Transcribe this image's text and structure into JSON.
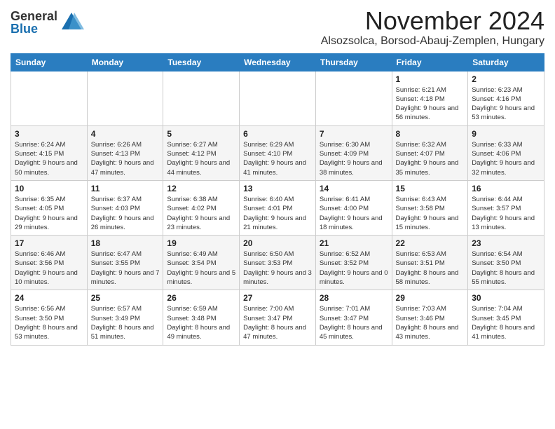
{
  "header": {
    "logo_general": "General",
    "logo_blue": "Blue",
    "month_title": "November 2024",
    "location": "Alsozsolca, Borsod-Abauj-Zemplen, Hungary"
  },
  "weekdays": [
    "Sunday",
    "Monday",
    "Tuesday",
    "Wednesday",
    "Thursday",
    "Friday",
    "Saturday"
  ],
  "weeks": [
    [
      {
        "day": "",
        "detail": ""
      },
      {
        "day": "",
        "detail": ""
      },
      {
        "day": "",
        "detail": ""
      },
      {
        "day": "",
        "detail": ""
      },
      {
        "day": "",
        "detail": ""
      },
      {
        "day": "1",
        "detail": "Sunrise: 6:21 AM\nSunset: 4:18 PM\nDaylight: 9 hours and 56 minutes."
      },
      {
        "day": "2",
        "detail": "Sunrise: 6:23 AM\nSunset: 4:16 PM\nDaylight: 9 hours and 53 minutes."
      }
    ],
    [
      {
        "day": "3",
        "detail": "Sunrise: 6:24 AM\nSunset: 4:15 PM\nDaylight: 9 hours and 50 minutes."
      },
      {
        "day": "4",
        "detail": "Sunrise: 6:26 AM\nSunset: 4:13 PM\nDaylight: 9 hours and 47 minutes."
      },
      {
        "day": "5",
        "detail": "Sunrise: 6:27 AM\nSunset: 4:12 PM\nDaylight: 9 hours and 44 minutes."
      },
      {
        "day": "6",
        "detail": "Sunrise: 6:29 AM\nSunset: 4:10 PM\nDaylight: 9 hours and 41 minutes."
      },
      {
        "day": "7",
        "detail": "Sunrise: 6:30 AM\nSunset: 4:09 PM\nDaylight: 9 hours and 38 minutes."
      },
      {
        "day": "8",
        "detail": "Sunrise: 6:32 AM\nSunset: 4:07 PM\nDaylight: 9 hours and 35 minutes."
      },
      {
        "day": "9",
        "detail": "Sunrise: 6:33 AM\nSunset: 4:06 PM\nDaylight: 9 hours and 32 minutes."
      }
    ],
    [
      {
        "day": "10",
        "detail": "Sunrise: 6:35 AM\nSunset: 4:05 PM\nDaylight: 9 hours and 29 minutes."
      },
      {
        "day": "11",
        "detail": "Sunrise: 6:37 AM\nSunset: 4:03 PM\nDaylight: 9 hours and 26 minutes."
      },
      {
        "day": "12",
        "detail": "Sunrise: 6:38 AM\nSunset: 4:02 PM\nDaylight: 9 hours and 23 minutes."
      },
      {
        "day": "13",
        "detail": "Sunrise: 6:40 AM\nSunset: 4:01 PM\nDaylight: 9 hours and 21 minutes."
      },
      {
        "day": "14",
        "detail": "Sunrise: 6:41 AM\nSunset: 4:00 PM\nDaylight: 9 hours and 18 minutes."
      },
      {
        "day": "15",
        "detail": "Sunrise: 6:43 AM\nSunset: 3:58 PM\nDaylight: 9 hours and 15 minutes."
      },
      {
        "day": "16",
        "detail": "Sunrise: 6:44 AM\nSunset: 3:57 PM\nDaylight: 9 hours and 13 minutes."
      }
    ],
    [
      {
        "day": "17",
        "detail": "Sunrise: 6:46 AM\nSunset: 3:56 PM\nDaylight: 9 hours and 10 minutes."
      },
      {
        "day": "18",
        "detail": "Sunrise: 6:47 AM\nSunset: 3:55 PM\nDaylight: 9 hours and 7 minutes."
      },
      {
        "day": "19",
        "detail": "Sunrise: 6:49 AM\nSunset: 3:54 PM\nDaylight: 9 hours and 5 minutes."
      },
      {
        "day": "20",
        "detail": "Sunrise: 6:50 AM\nSunset: 3:53 PM\nDaylight: 9 hours and 3 minutes."
      },
      {
        "day": "21",
        "detail": "Sunrise: 6:52 AM\nSunset: 3:52 PM\nDaylight: 9 hours and 0 minutes."
      },
      {
        "day": "22",
        "detail": "Sunrise: 6:53 AM\nSunset: 3:51 PM\nDaylight: 8 hours and 58 minutes."
      },
      {
        "day": "23",
        "detail": "Sunrise: 6:54 AM\nSunset: 3:50 PM\nDaylight: 8 hours and 55 minutes."
      }
    ],
    [
      {
        "day": "24",
        "detail": "Sunrise: 6:56 AM\nSunset: 3:50 PM\nDaylight: 8 hours and 53 minutes."
      },
      {
        "day": "25",
        "detail": "Sunrise: 6:57 AM\nSunset: 3:49 PM\nDaylight: 8 hours and 51 minutes."
      },
      {
        "day": "26",
        "detail": "Sunrise: 6:59 AM\nSunset: 3:48 PM\nDaylight: 8 hours and 49 minutes."
      },
      {
        "day": "27",
        "detail": "Sunrise: 7:00 AM\nSunset: 3:47 PM\nDaylight: 8 hours and 47 minutes."
      },
      {
        "day": "28",
        "detail": "Sunrise: 7:01 AM\nSunset: 3:47 PM\nDaylight: 8 hours and 45 minutes."
      },
      {
        "day": "29",
        "detail": "Sunrise: 7:03 AM\nSunset: 3:46 PM\nDaylight: 8 hours and 43 minutes."
      },
      {
        "day": "30",
        "detail": "Sunrise: 7:04 AM\nSunset: 3:45 PM\nDaylight: 8 hours and 41 minutes."
      }
    ]
  ]
}
